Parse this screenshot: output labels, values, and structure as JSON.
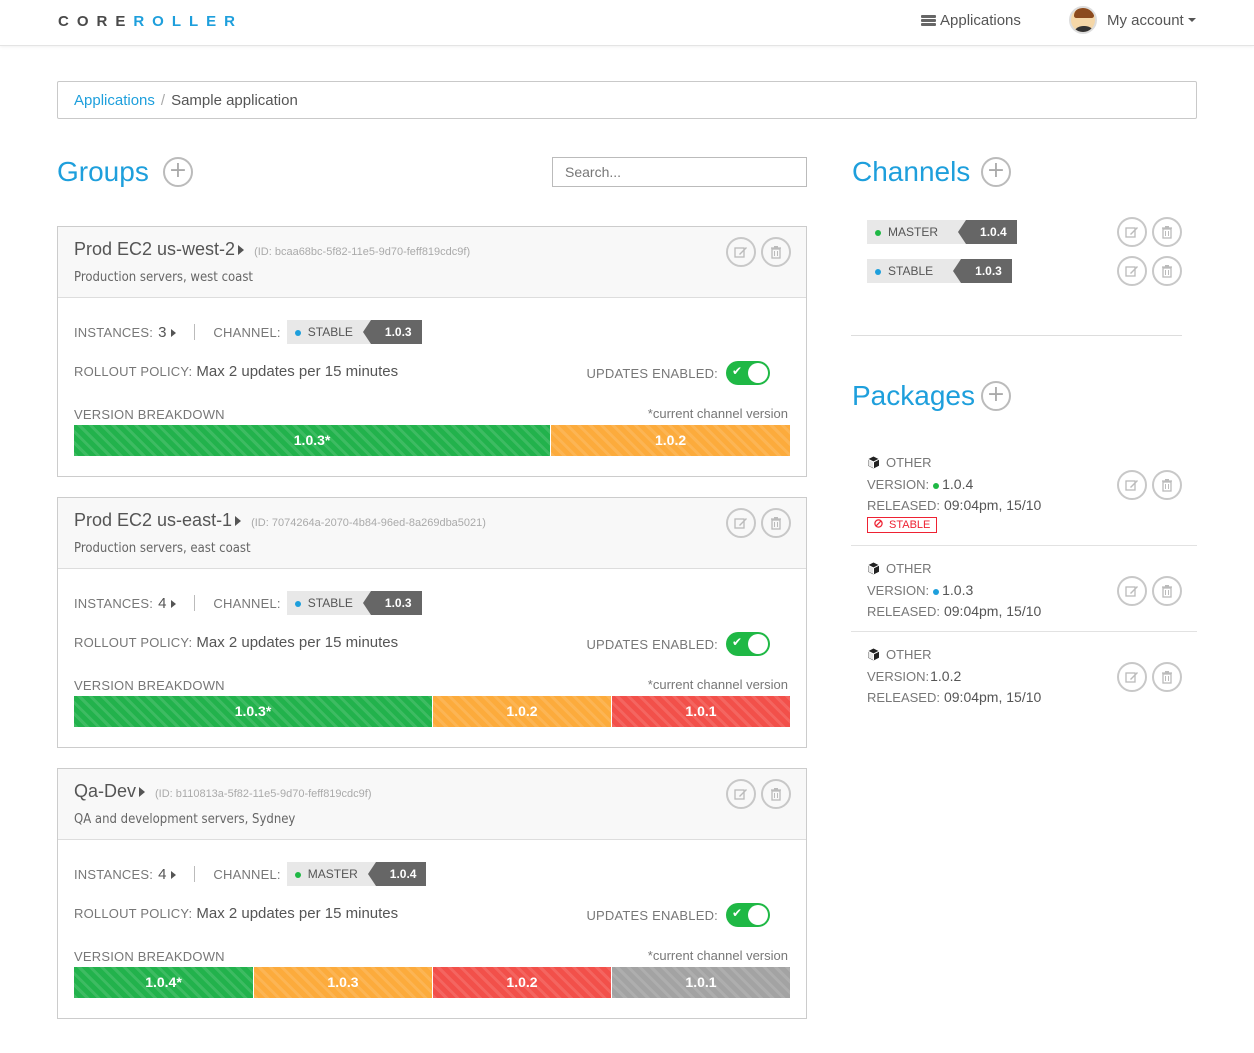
{
  "nav": {
    "logo_core": "CORE",
    "logo_roller": "ROLLER",
    "applications": "Applications",
    "account": "My account"
  },
  "breadcrumb": {
    "root": "Applications",
    "current": "Sample application"
  },
  "groups_section": {
    "title": "Groups",
    "search_placeholder": "Search..."
  },
  "labels": {
    "instances": "INSTANCES:",
    "channel": "CHANNEL:",
    "rollout_policy": "ROLLOUT POLICY:",
    "updates_enabled": "UPDATES ENABLED:",
    "version_breakdown": "VERSION BREAKDOWN",
    "current_channel_version": "*current channel version"
  },
  "groups": [
    {
      "name": "Prod EC2 us-west-2",
      "id": "(ID: bcaa68bc-5f82-11e5-9d70-feff819cdc9f)",
      "description": "Production servers, west coast",
      "instances": "3",
      "channel_name": "STABLE",
      "channel_version": "1.0.3",
      "channel_color": "#1e9fdc",
      "rollout": "Max 2 updates per 15 minutes",
      "updates_enabled": true,
      "breakdown": [
        {
          "label": "1.0.3*",
          "percent": 66.5,
          "color": "#22b24c"
        },
        {
          "label": "1.0.2",
          "percent": 33.5,
          "color": "#fcab3c"
        }
      ]
    },
    {
      "name": "Prod EC2 us-east-1",
      "id": "(ID: 7074264a-2070-4b84-96ed-8a269dba5021)",
      "description": "Production servers, east coast",
      "instances": "4",
      "channel_name": "STABLE",
      "channel_version": "1.0.3",
      "channel_color": "#1e9fdc",
      "rollout": "Max 2 updates per 15 minutes",
      "updates_enabled": true,
      "breakdown": [
        {
          "label": "1.0.3*",
          "percent": 50,
          "color": "#22b24c"
        },
        {
          "label": "1.0.2",
          "percent": 25,
          "color": "#fcab3c"
        },
        {
          "label": "1.0.1",
          "percent": 25,
          "color": "#f2504a"
        }
      ]
    },
    {
      "name": "Qa-Dev",
      "id": "(ID: b110813a-5f82-11e5-9d70-feff819cdc9f)",
      "description": "QA and development servers, Sydney",
      "instances": "4",
      "channel_name": "MASTER",
      "channel_version": "1.0.4",
      "channel_color": "#1fb845",
      "rollout": "Max 2 updates per 15 minutes",
      "updates_enabled": true,
      "breakdown": [
        {
          "label": "1.0.4*",
          "percent": 25,
          "color": "#22b24c"
        },
        {
          "label": "1.0.3",
          "percent": 25,
          "color": "#fcab3c"
        },
        {
          "label": "1.0.2",
          "percent": 25,
          "color": "#f2504a"
        },
        {
          "label": "1.0.1",
          "percent": 25,
          "color": "#a3a3a3"
        }
      ]
    }
  ],
  "channels_section": {
    "title": "Channels"
  },
  "channels": [
    {
      "name": "MASTER",
      "version": "1.0.4",
      "color": "#1fb845"
    },
    {
      "name": "STABLE",
      "version": "1.0.3",
      "color": "#1e9fdc"
    }
  ],
  "packages_section": {
    "title": "Packages"
  },
  "package_labels": {
    "version": "VERSION:",
    "released": "RELEASED:"
  },
  "packages": [
    {
      "type": "OTHER",
      "version": "1.0.4",
      "dot_color": "#1fb845",
      "released": "09:04pm, 15/10",
      "badge": "STABLE"
    },
    {
      "type": "OTHER",
      "version": "1.0.3",
      "dot_color": "#1e9fdc",
      "released": "09:04pm, 15/10"
    },
    {
      "type": "OTHER",
      "version": "1.0.2",
      "released": "09:04pm, 15/10"
    }
  ]
}
